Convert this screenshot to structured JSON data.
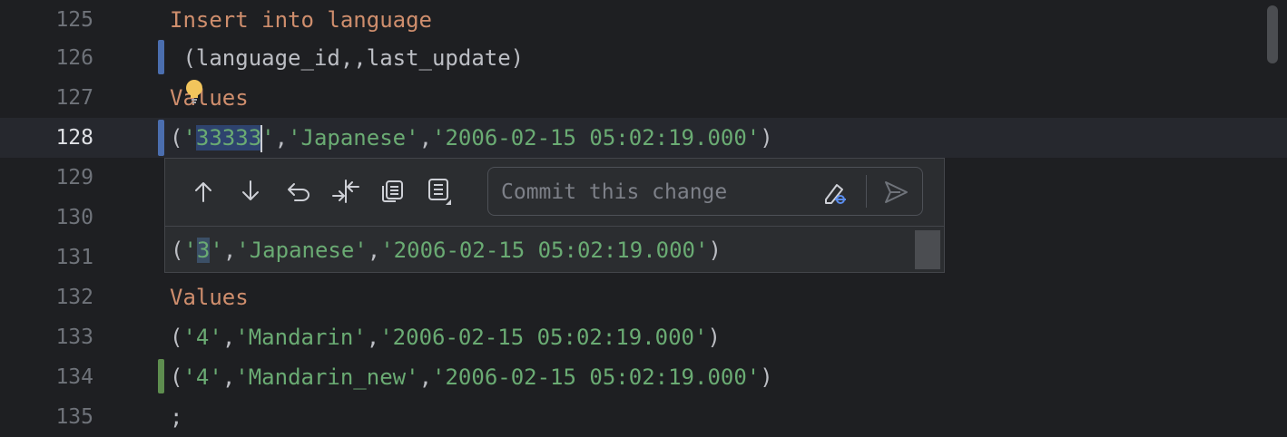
{
  "editor": {
    "lines": [
      {
        "num": "125",
        "t1": "Insert into language"
      },
      {
        "num": "126",
        "t1": " (language_id,,last_update)"
      },
      {
        "num": "127",
        "t1": "Values"
      },
      {
        "num": "128",
        "p1": "(",
        "q1": "'",
        "sel": "33333",
        "q2": "'",
        "p2": ",",
        "s2": "'Japanese'",
        "p3": ",",
        "s3": "'2006-02-15 05:02:19.000'",
        "p4": ")"
      },
      {
        "num": "129"
      },
      {
        "num": "130"
      },
      {
        "num": "131"
      },
      {
        "num": "132",
        "t1": "Values"
      },
      {
        "num": "133",
        "p1": "(",
        "s1": "'4'",
        "p2": ",",
        "s2": "'Mandarin'",
        "p3": ",",
        "s3": "'2006-02-15 05:02:19.000'",
        "p4": ")"
      },
      {
        "num": "134",
        "p1": "(",
        "s1": "'4'",
        "p2": ",",
        "s2": "'Mandarin_new'",
        "p3": ",",
        "s3": "'2006-02-15 05:02:19.000'",
        "p4": ")"
      },
      {
        "num": "135",
        "t1": ";"
      }
    ]
  },
  "diff_popup": {
    "commit_placeholder": "Commit this change",
    "commit_value": "",
    "old_line": {
      "p1": "(",
      "q1": "'",
      "sel": "3",
      "q2": "'",
      "p2": ",",
      "s2": "'Japanese'",
      "p3": ",",
      "s3": "'2006-02-15 05:02:19.000'",
      "p4": ")"
    },
    "icons": [
      "arrow-up-icon",
      "arrow-down-icon",
      "rollback-icon",
      "compare-icon",
      "copy-icon",
      "show-diff-options-icon",
      "edit-pencil-icon",
      "send-icon"
    ]
  },
  "colors": {
    "background": "#1e1f22",
    "keyword": "#cf8e6d",
    "string": "#6aab73",
    "text": "#bcbec4",
    "selection": "#2e436e",
    "modified_marker": "#4b6eaf",
    "added_marker": "#5e8d4f"
  }
}
